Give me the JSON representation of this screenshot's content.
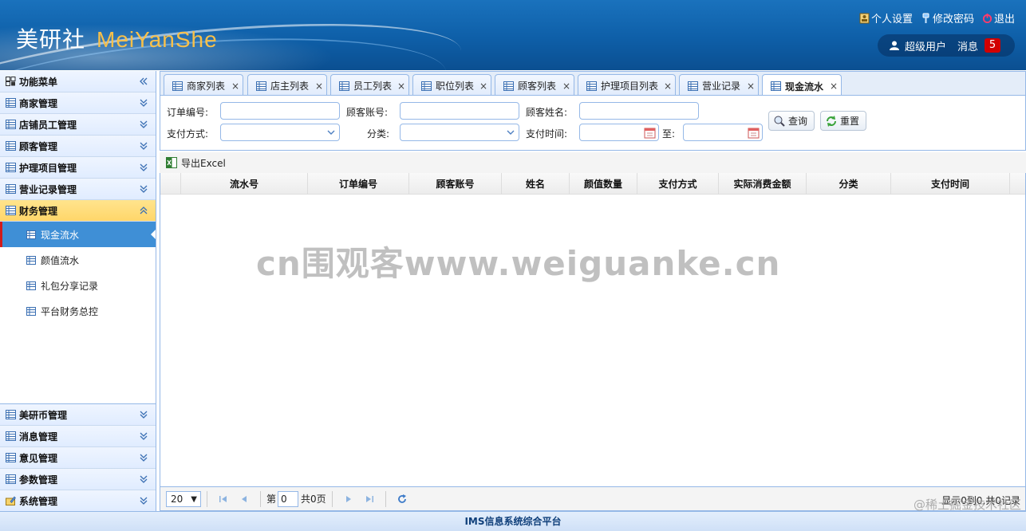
{
  "header": {
    "logo_cn": "美研社",
    "logo_en": "MeiYanShe",
    "links": {
      "settings": "个人设置",
      "password": "修改密码",
      "logout": "退出"
    },
    "user": "超级用户",
    "messages_label": "消息",
    "messages_count": "5"
  },
  "sidebar": {
    "title": "功能菜单",
    "groups": [
      {
        "label": "商家管理"
      },
      {
        "label": "店铺员工管理"
      },
      {
        "label": "顾客管理"
      },
      {
        "label": "护理项目管理"
      },
      {
        "label": "营业记录管理"
      },
      {
        "label": "财务管理",
        "expanded": true
      }
    ],
    "finance_items": [
      "现金流水",
      "颜值流水",
      "礼包分享记录",
      "平台财务总控"
    ],
    "selected_item": "现金流水",
    "bottom_groups": [
      {
        "label": "美研币管理"
      },
      {
        "label": "消息管理"
      },
      {
        "label": "意见管理"
      },
      {
        "label": "参数管理"
      },
      {
        "label": "系统管理"
      }
    ]
  },
  "tabs": [
    {
      "label": "商家列表"
    },
    {
      "label": "店主列表"
    },
    {
      "label": "员工列表"
    },
    {
      "label": "职位列表"
    },
    {
      "label": "顾客列表"
    },
    {
      "label": "护理项目列表"
    },
    {
      "label": "营业记录"
    },
    {
      "label": "现金流水",
      "active": true
    }
  ],
  "filter": {
    "order_no": "订单编号:",
    "customer_account": "顾客账号:",
    "customer_name": "顾客姓名:",
    "pay_method": "支付方式:",
    "category": "分类:",
    "pay_time": "支付时间:",
    "to": "至:",
    "query_btn": "查询",
    "reset_btn": "重置"
  },
  "toolbar": {
    "export": "导出Excel"
  },
  "grid": {
    "columns": [
      "流水号",
      "订单编号",
      "顾客账号",
      "姓名",
      "颜值数量",
      "支付方式",
      "实际消费金额",
      "分类",
      "支付时间"
    ],
    "rows": []
  },
  "watermark": "cn围观客www.weiguanke.cn",
  "pager": {
    "page_size": "20",
    "page_prefix": "第",
    "page_value": "0",
    "page_total": "共0页",
    "info": "显示0到0,共0记录"
  },
  "footer": "IMS信息系统综合平台",
  "credit": "@稀土掘金技术社区",
  "colors": {
    "header": "#0e5fa8",
    "accent": "#3f8fd6",
    "active_group": "#ffd66a",
    "badge": "#d10000"
  }
}
